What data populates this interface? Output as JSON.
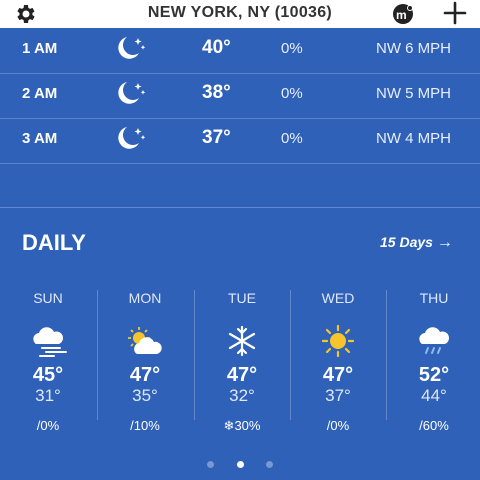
{
  "header": {
    "location": "NEW YORK, NY (10036)",
    "settings_icon": "gear-icon",
    "mi_icon": "mi-logo-icon",
    "add_icon": "plus-icon"
  },
  "hourly": [
    {
      "time": "1 AM",
      "icon": "moon-stars-icon",
      "temp": "40°",
      "precip": "0%",
      "wind": "NW 6 MPH"
    },
    {
      "time": "2 AM",
      "icon": "moon-stars-icon",
      "temp": "38°",
      "precip": "0%",
      "wind": "NW 5 MPH"
    },
    {
      "time": "3 AM",
      "icon": "moon-stars-icon",
      "temp": "37°",
      "precip": "0%",
      "wind": "NW 4 MPH"
    }
  ],
  "daily": {
    "title": "DAILY",
    "link": "15 Days",
    "days": [
      {
        "name": "SUN",
        "icon": "cloud-wind-icon",
        "hi": "45°",
        "lo": "31°",
        "precip": "0%",
        "precip_icon": "rain-drop-icon"
      },
      {
        "name": "MON",
        "icon": "partly-cloudy-icon",
        "hi": "47°",
        "lo": "35°",
        "precip": "10%",
        "precip_icon": "rain-drop-icon"
      },
      {
        "name": "TUE",
        "icon": "snowflake-icon",
        "hi": "47°",
        "lo": "32°",
        "precip": "30%",
        "precip_icon": "snowflake-icon"
      },
      {
        "name": "WED",
        "icon": "sun-icon",
        "hi": "47°",
        "lo": "37°",
        "precip": "0%",
        "precip_icon": "rain-drop-icon"
      },
      {
        "name": "THU",
        "icon": "cloud-rain-icon",
        "hi": "52°",
        "lo": "44°",
        "precip": "60%",
        "precip_icon": "rain-drop-icon"
      }
    ]
  },
  "pager": {
    "count": 3,
    "active": 1
  },
  "colors": {
    "background": "#2f61b8",
    "header": "#ffffff",
    "sun": "#f7c52b"
  }
}
